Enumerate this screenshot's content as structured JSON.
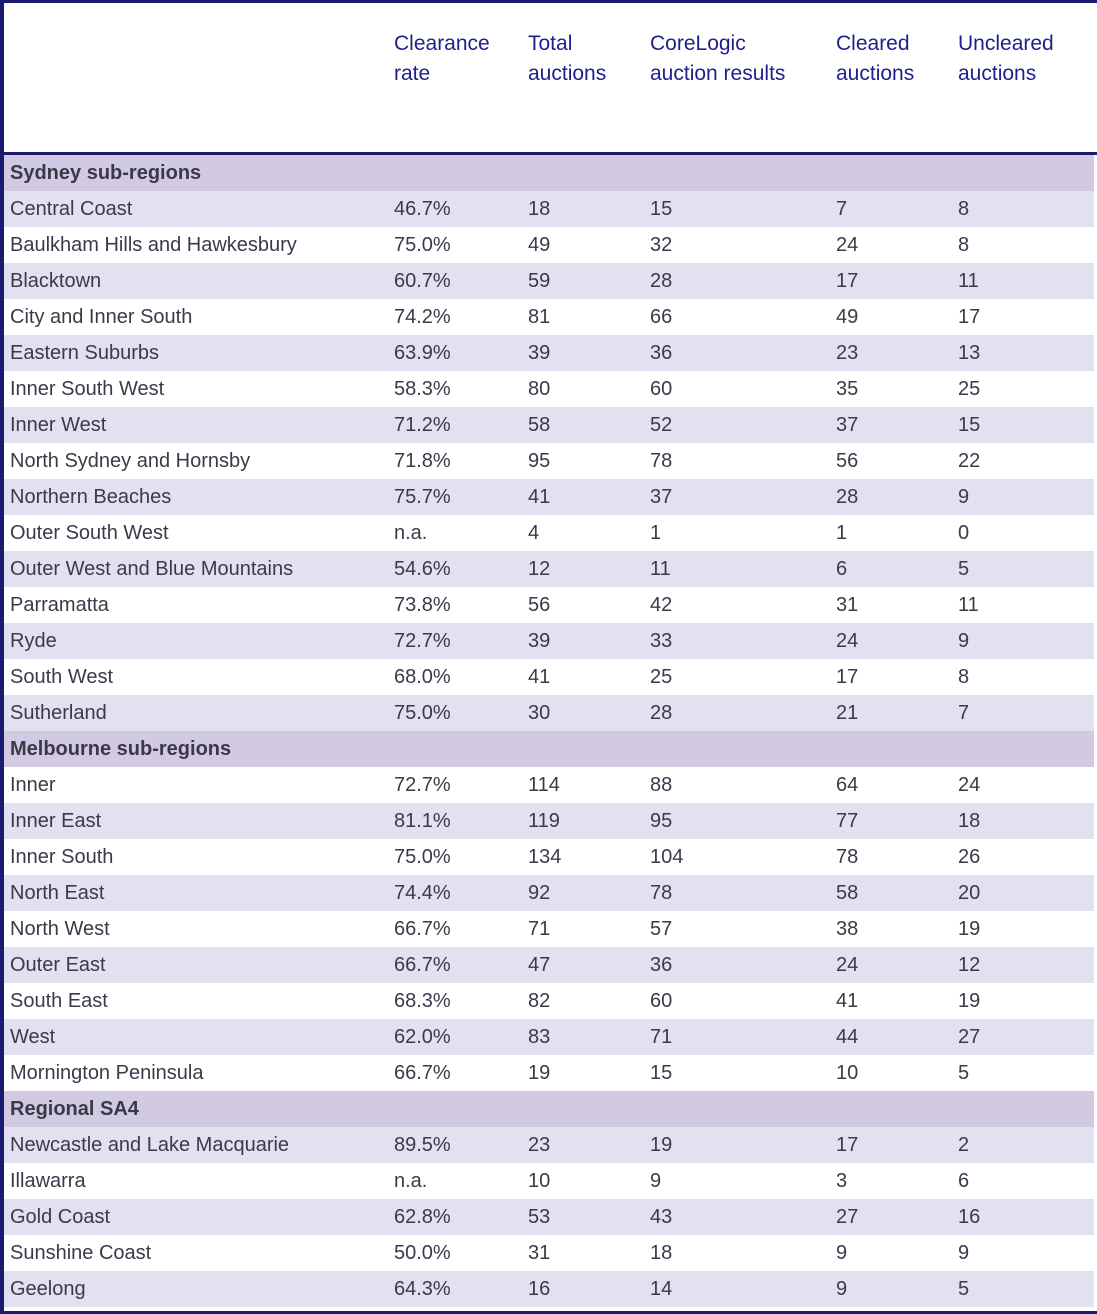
{
  "table": {
    "columns": [
      {
        "key": "region",
        "line1": "",
        "line2": ""
      },
      {
        "key": "rate",
        "line1": "Clearance",
        "line2": "rate"
      },
      {
        "key": "total",
        "line1": "Total",
        "line2": "auctions"
      },
      {
        "key": "core",
        "line1": "CoreLogic",
        "line2": "auction results"
      },
      {
        "key": "cleared",
        "line1": "Cleared",
        "line2": "auctions"
      },
      {
        "key": "uncleared",
        "line1": "Uncleared",
        "line2": "auctions"
      }
    ],
    "colors": {
      "header_text": "#1f1f8c",
      "border": "#1a1a6e",
      "section_bg": "#d2cae2",
      "alt_row_bg": "#e3e0ef",
      "plain_row_bg": "#ffffff",
      "cell_text": "#3a3a4a"
    },
    "rows": [
      {
        "type": "section",
        "region": "Sydney sub-regions",
        "rate": "",
        "total": "",
        "core": "",
        "cleared": "",
        "uncleared": ""
      },
      {
        "type": "data",
        "region": "Central Coast",
        "rate": "46.7%",
        "total": "18",
        "core": "15",
        "cleared": "7",
        "uncleared": "8"
      },
      {
        "type": "data",
        "region": "Baulkham Hills and Hawkesbury",
        "rate": "75.0%",
        "total": "49",
        "core": "32",
        "cleared": "24",
        "uncleared": "8"
      },
      {
        "type": "data",
        "region": "Blacktown",
        "rate": "60.7%",
        "total": "59",
        "core": "28",
        "cleared": "17",
        "uncleared": "11"
      },
      {
        "type": "data",
        "region": "City and Inner South",
        "rate": "74.2%",
        "total": "81",
        "core": "66",
        "cleared": "49",
        "uncleared": "17"
      },
      {
        "type": "data",
        "region": "Eastern Suburbs",
        "rate": "63.9%",
        "total": "39",
        "core": "36",
        "cleared": "23",
        "uncleared": "13"
      },
      {
        "type": "data",
        "region": "Inner South West",
        "rate": "58.3%",
        "total": "80",
        "core": "60",
        "cleared": "35",
        "uncleared": "25"
      },
      {
        "type": "data",
        "region": "Inner West",
        "rate": "71.2%",
        "total": "58",
        "core": "52",
        "cleared": "37",
        "uncleared": "15"
      },
      {
        "type": "data",
        "region": "North Sydney and Hornsby",
        "rate": "71.8%",
        "total": "95",
        "core": "78",
        "cleared": "56",
        "uncleared": "22"
      },
      {
        "type": "data",
        "region": "Northern Beaches",
        "rate": "75.7%",
        "total": "41",
        "core": "37",
        "cleared": "28",
        "uncleared": "9"
      },
      {
        "type": "data",
        "region": "Outer South West",
        "rate": "n.a.",
        "total": "4",
        "core": "1",
        "cleared": "1",
        "uncleared": "0"
      },
      {
        "type": "data",
        "region": "Outer West and Blue Mountains",
        "rate": "54.6%",
        "total": "12",
        "core": "11",
        "cleared": "6",
        "uncleared": "5"
      },
      {
        "type": "data",
        "region": "Parramatta",
        "rate": "73.8%",
        "total": "56",
        "core": "42",
        "cleared": "31",
        "uncleared": "11"
      },
      {
        "type": "data",
        "region": "Ryde",
        "rate": "72.7%",
        "total": "39",
        "core": "33",
        "cleared": "24",
        "uncleared": "9"
      },
      {
        "type": "data",
        "region": "South West",
        "rate": "68.0%",
        "total": "41",
        "core": "25",
        "cleared": "17",
        "uncleared": "8"
      },
      {
        "type": "data",
        "region": "Sutherland",
        "rate": "75.0%",
        "total": "30",
        "core": "28",
        "cleared": "21",
        "uncleared": "7"
      },
      {
        "type": "section",
        "region": "Melbourne sub-regions",
        "rate": "",
        "total": "",
        "core": "",
        "cleared": "",
        "uncleared": ""
      },
      {
        "type": "data",
        "region": "Inner",
        "rate": "72.7%",
        "total": "114",
        "core": "88",
        "cleared": "64",
        "uncleared": "24"
      },
      {
        "type": "data",
        "region": "Inner East",
        "rate": "81.1%",
        "total": "119",
        "core": "95",
        "cleared": "77",
        "uncleared": "18"
      },
      {
        "type": "data",
        "region": "Inner South",
        "rate": "75.0%",
        "total": "134",
        "core": "104",
        "cleared": "78",
        "uncleared": "26"
      },
      {
        "type": "data",
        "region": "North East",
        "rate": "74.4%",
        "total": "92",
        "core": "78",
        "cleared": "58",
        "uncleared": "20"
      },
      {
        "type": "data",
        "region": "North West",
        "rate": "66.7%",
        "total": "71",
        "core": "57",
        "cleared": "38",
        "uncleared": "19"
      },
      {
        "type": "data",
        "region": "Outer East",
        "rate": "66.7%",
        "total": "47",
        "core": "36",
        "cleared": "24",
        "uncleared": "12"
      },
      {
        "type": "data",
        "region": "South East",
        "rate": "68.3%",
        "total": "82",
        "core": "60",
        "cleared": "41",
        "uncleared": "19"
      },
      {
        "type": "data",
        "region": "West",
        "rate": "62.0%",
        "total": "83",
        "core": "71",
        "cleared": "44",
        "uncleared": "27"
      },
      {
        "type": "data",
        "region": "Mornington Peninsula",
        "rate": "66.7%",
        "total": "19",
        "core": "15",
        "cleared": "10",
        "uncleared": "5"
      },
      {
        "type": "section",
        "region": "Regional SA4",
        "rate": "",
        "total": "",
        "core": "",
        "cleared": "",
        "uncleared": ""
      },
      {
        "type": "data",
        "region": "Newcastle and Lake Macquarie",
        "rate": "89.5%",
        "total": "23",
        "core": "19",
        "cleared": "17",
        "uncleared": "2"
      },
      {
        "type": "data",
        "region": "Illawarra",
        "rate": "n.a.",
        "total": "10",
        "core": "9",
        "cleared": "3",
        "uncleared": "6"
      },
      {
        "type": "data",
        "region": "Gold Coast",
        "rate": "62.8%",
        "total": "53",
        "core": "43",
        "cleared": "27",
        "uncleared": "16"
      },
      {
        "type": "data",
        "region": "Sunshine Coast",
        "rate": "50.0%",
        "total": "31",
        "core": "18",
        "cleared": "9",
        "uncleared": "9"
      },
      {
        "type": "data",
        "region": "Geelong",
        "rate": "64.3%",
        "total": "16",
        "core": "14",
        "cleared": "9",
        "uncleared": "5"
      }
    ]
  }
}
